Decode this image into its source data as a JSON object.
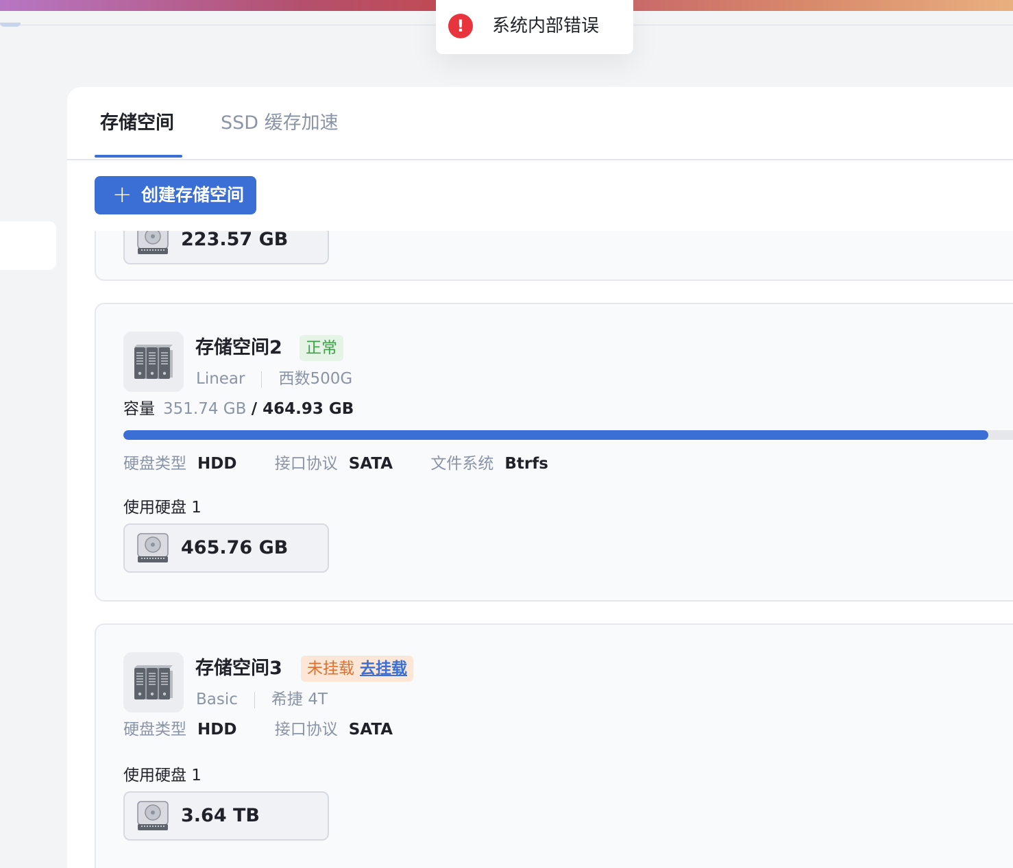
{
  "toast": {
    "message": "系统内部错误",
    "icon": "error-exclamation-icon",
    "icon_glyph": "!"
  },
  "tabs": [
    {
      "label": "存储空间",
      "active": true
    },
    {
      "label": "SSD 缓存加速",
      "active": false
    }
  ],
  "create_button": {
    "icon_glyph": "+",
    "label": "创建存储空间"
  },
  "pools": [
    {
      "partial_disk_size": "223.57 GB"
    },
    {
      "name": "存储空间2",
      "status": "正常",
      "raid": "Linear",
      "model": "西数500G",
      "capacity_label": "容量",
      "used": "351.74 GB",
      "total": "/ 464.93 GB",
      "usage_fraction": 0.928,
      "props": [
        {
          "key": "硬盘类型",
          "value": "HDD"
        },
        {
          "key": "接口协议",
          "value": "SATA"
        },
        {
          "key": "文件系统",
          "value": "Btrfs"
        }
      ],
      "disks_label": "使用硬盘 1",
      "disks": [
        {
          "size": "465.76 GB"
        }
      ]
    },
    {
      "name": "存储空间3",
      "status": "未挂载",
      "action": "去挂载",
      "raid": "Basic",
      "model": "希捷 4T",
      "props": [
        {
          "key": "硬盘类型",
          "value": "HDD"
        },
        {
          "key": "接口协议",
          "value": "SATA"
        }
      ],
      "disks_label": "使用硬盘 1",
      "disks": [
        {
          "size": "3.64 TB"
        }
      ]
    }
  ],
  "colors": {
    "accent": "#3b6fd6",
    "ok": "#3ea047",
    "warn": "#e06f2b",
    "error": "#e8343c"
  }
}
